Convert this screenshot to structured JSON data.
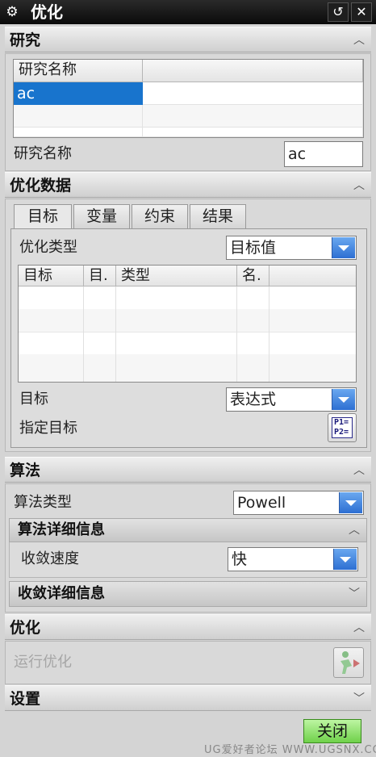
{
  "window": {
    "title": "优化",
    "icon": "gear-icon",
    "buttons": [
      "refresh-icon",
      "close-icon"
    ]
  },
  "study": {
    "header": "研究",
    "table": {
      "columns": [
        "研究名称",
        ""
      ],
      "rows": [
        [
          "ac",
          ""
        ],
        [
          "",
          ""
        ],
        [
          "",
          ""
        ]
      ]
    },
    "name_label": "研究名称",
    "name_value": "ac"
  },
  "opt_data": {
    "header": "优化数据",
    "tabs": [
      "目标",
      "变量",
      "约束",
      "结果"
    ],
    "active_tab": "目标",
    "type_label": "优化类型",
    "type_value": "目标值",
    "table": {
      "columns": [
        "目标",
        "目.",
        "类型",
        "名.",
        ""
      ]
    },
    "objective_label": "目标",
    "objective_value": "表达式",
    "specify_label": "指定目标",
    "specify_icon_text": [
      "P1=",
      "P2="
    ]
  },
  "algorithm": {
    "header": "算法",
    "type_label": "算法类型",
    "type_value": "Powell",
    "details_header": "算法详细信息",
    "speed_label": "收敛速度",
    "speed_value": "快",
    "convergence_header": "收敛详细信息"
  },
  "optimize": {
    "header": "优化",
    "run_label": "运行优化"
  },
  "settings": {
    "header": "设置"
  },
  "footer": {
    "close_label": "关闭",
    "watermark": "UG爱好者论坛 WWW.UGSNX.COM"
  }
}
